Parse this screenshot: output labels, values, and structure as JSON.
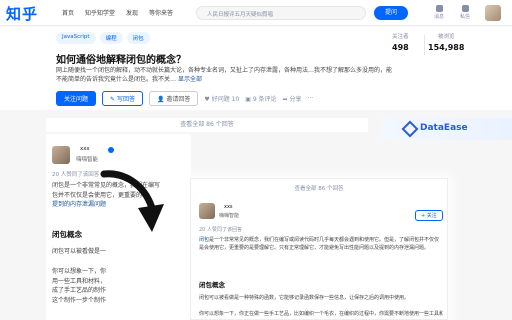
{
  "nav": {
    "logo": "知乎",
    "links": [
      "首页",
      "知乎知学堂",
      "发现",
      "等你来答"
    ],
    "search_placeholder": "人民日报评五月天疑似假唱",
    "ask_label": "提问",
    "icons": [
      {
        "name": "bell-icon",
        "label": "消息"
      },
      {
        "name": "message-icon",
        "label": "私信"
      }
    ]
  },
  "question": {
    "tags": [
      "JavaScript",
      "编程",
      "闭包"
    ],
    "title": "如何通俗地解释闭包的概念？",
    "desc": "网上随便找一个闭包的解释，动不动就长篇大论，各种专业名词，又扯上了内存泄露，各种用法…我不想了解那么多没用的，能不能简单的告诉我究竟什么是闭包。我不关…",
    "more_label": "显示全部",
    "stats": {
      "followers_label": "关注者",
      "followers": "498",
      "views_label": "被浏览",
      "views": "154,988"
    },
    "actions": {
      "follow": "关注问题",
      "answer": "写回答",
      "invite": "邀请回答",
      "like": "好问题 10",
      "comments": "9 条评论",
      "share": "分享"
    }
  },
  "answers": {
    "view_all": "查看全部 86 个回答",
    "ad_brand": "DataEase",
    "author": {
      "name": "xxs",
      "subtitle": "嗨嗨智能"
    },
    "follow_label": "+ 关注",
    "agree_meta": "20 人赞同了该回答",
    "intro_start": "闭包",
    "intro_text": "是一个非常常见的概念，我们在编写或阅读代码时几乎每天都会遇到和使用它。但是，了解闭包并不仅仅是会使用它，更重要的是要理解它。只有正常理解它，才能避免写出性能问题以及提到的内存泄漏问题。",
    "intro_link": "内存泄漏",
    "section_title": "闭包概念",
    "section_text": "闭包可以被看做是一种特殊的函数，它能够记录函数保存一些信息，让保存之后的调用中使用。",
    "section_text2": "你可以想象一下，你正在做一些手工艺品，比如编织一个毛衣，在编织的过程中，你需要不断地使用一些工具和材料。",
    "card_lines": {
      "intro": "闭包是一个非常常见的概念，我们在编写",
      "intro2": "包并不仅仅是会使用它，更重要的",
      "intro3": "提到的内存泄漏问题",
      "sec1": "闭包可以被看做是一",
      "sec2a": "你可以想象一下，你",
      "sec2b": "用一些工具和材料，",
      "sec2c": "成了手工艺品的制作",
      "sec2d": "这个制作一步个制作"
    }
  }
}
